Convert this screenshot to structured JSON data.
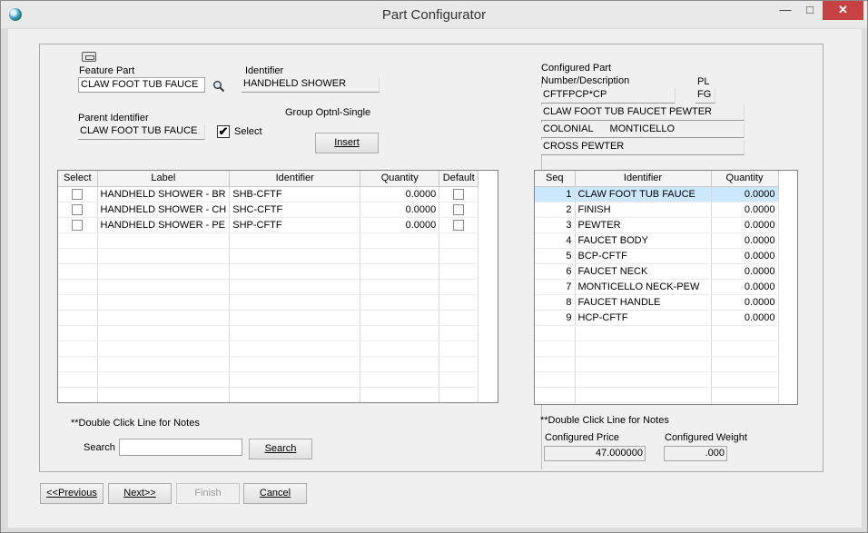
{
  "window": {
    "title": "Part Configurator"
  },
  "left": {
    "feature_part_label": "Feature Part",
    "feature_part_value": "CLAW FOOT TUB FAUCE",
    "identifier_label": "Identifier",
    "identifier_value": "HANDHELD SHOWER",
    "parent_identifier_label": "Parent Identifier",
    "parent_identifier_value": "CLAW FOOT TUB FAUCE",
    "select_label": "Select",
    "select_checked": "✔",
    "group_label": "Group Optnl-Single",
    "insert_button": "Insert",
    "grid": {
      "headers": [
        "Select",
        "Label",
        "Identifier",
        "Quantity",
        "Default"
      ],
      "rows": [
        {
          "label": "HANDHELD SHOWER - BR",
          "identifier": "SHB-CFTF",
          "quantity": "0.0000"
        },
        {
          "label": "HANDHELD SHOWER - CH",
          "identifier": "SHC-CFTF",
          "quantity": "0.0000"
        },
        {
          "label": "HANDHELD SHOWER - PE",
          "identifier": "SHP-CFTF",
          "quantity": "0.0000"
        }
      ]
    },
    "notes_hint": "**Double Click Line for Notes",
    "search_label": "Search",
    "search_value": "",
    "search_button": "Search"
  },
  "right": {
    "configured_part_label": "Configured Part",
    "number_description_label": "Number/Description",
    "pl_label": "PL",
    "part_number": "CFTFPCP*CP",
    "pl_value": "FG",
    "desc_line1": "CLAW FOOT TUB FAUCET PEWTER",
    "desc_line2": "COLONIAL      MONTICELLO",
    "desc_line3": "CROSS PEWTER",
    "grid": {
      "headers": [
        "Seq",
        "Identifier",
        "Quantity"
      ],
      "rows": [
        {
          "seq": "1",
          "identifier": "CLAW FOOT TUB FAUCE",
          "quantity": "0.0000"
        },
        {
          "seq": "2",
          "identifier": "FINISH",
          "quantity": "0.0000"
        },
        {
          "seq": "3",
          "identifier": "PEWTER",
          "quantity": "0.0000"
        },
        {
          "seq": "4",
          "identifier": "FAUCET BODY",
          "quantity": "0.0000"
        },
        {
          "seq": "5",
          "identifier": "BCP-CFTF",
          "quantity": "0.0000"
        },
        {
          "seq": "6",
          "identifier": "FAUCET NECK",
          "quantity": "0.0000"
        },
        {
          "seq": "7",
          "identifier": "MONTICELLO NECK-PEW",
          "quantity": "0.0000"
        },
        {
          "seq": "8",
          "identifier": "FAUCET HANDLE",
          "quantity": "0.0000"
        },
        {
          "seq": "9",
          "identifier": "HCP-CFTF",
          "quantity": "0.0000"
        }
      ]
    },
    "notes_hint": "**Double Click Line for Notes",
    "configured_price_label": "Configured Price",
    "configured_price_value": "47.000000",
    "configured_weight_label": "Configured Weight",
    "configured_weight_value": ".000"
  },
  "footer": {
    "previous_button": "<<Previous",
    "next_button": "Next>>",
    "finish_button": "Finish",
    "cancel_button": "Cancel"
  }
}
